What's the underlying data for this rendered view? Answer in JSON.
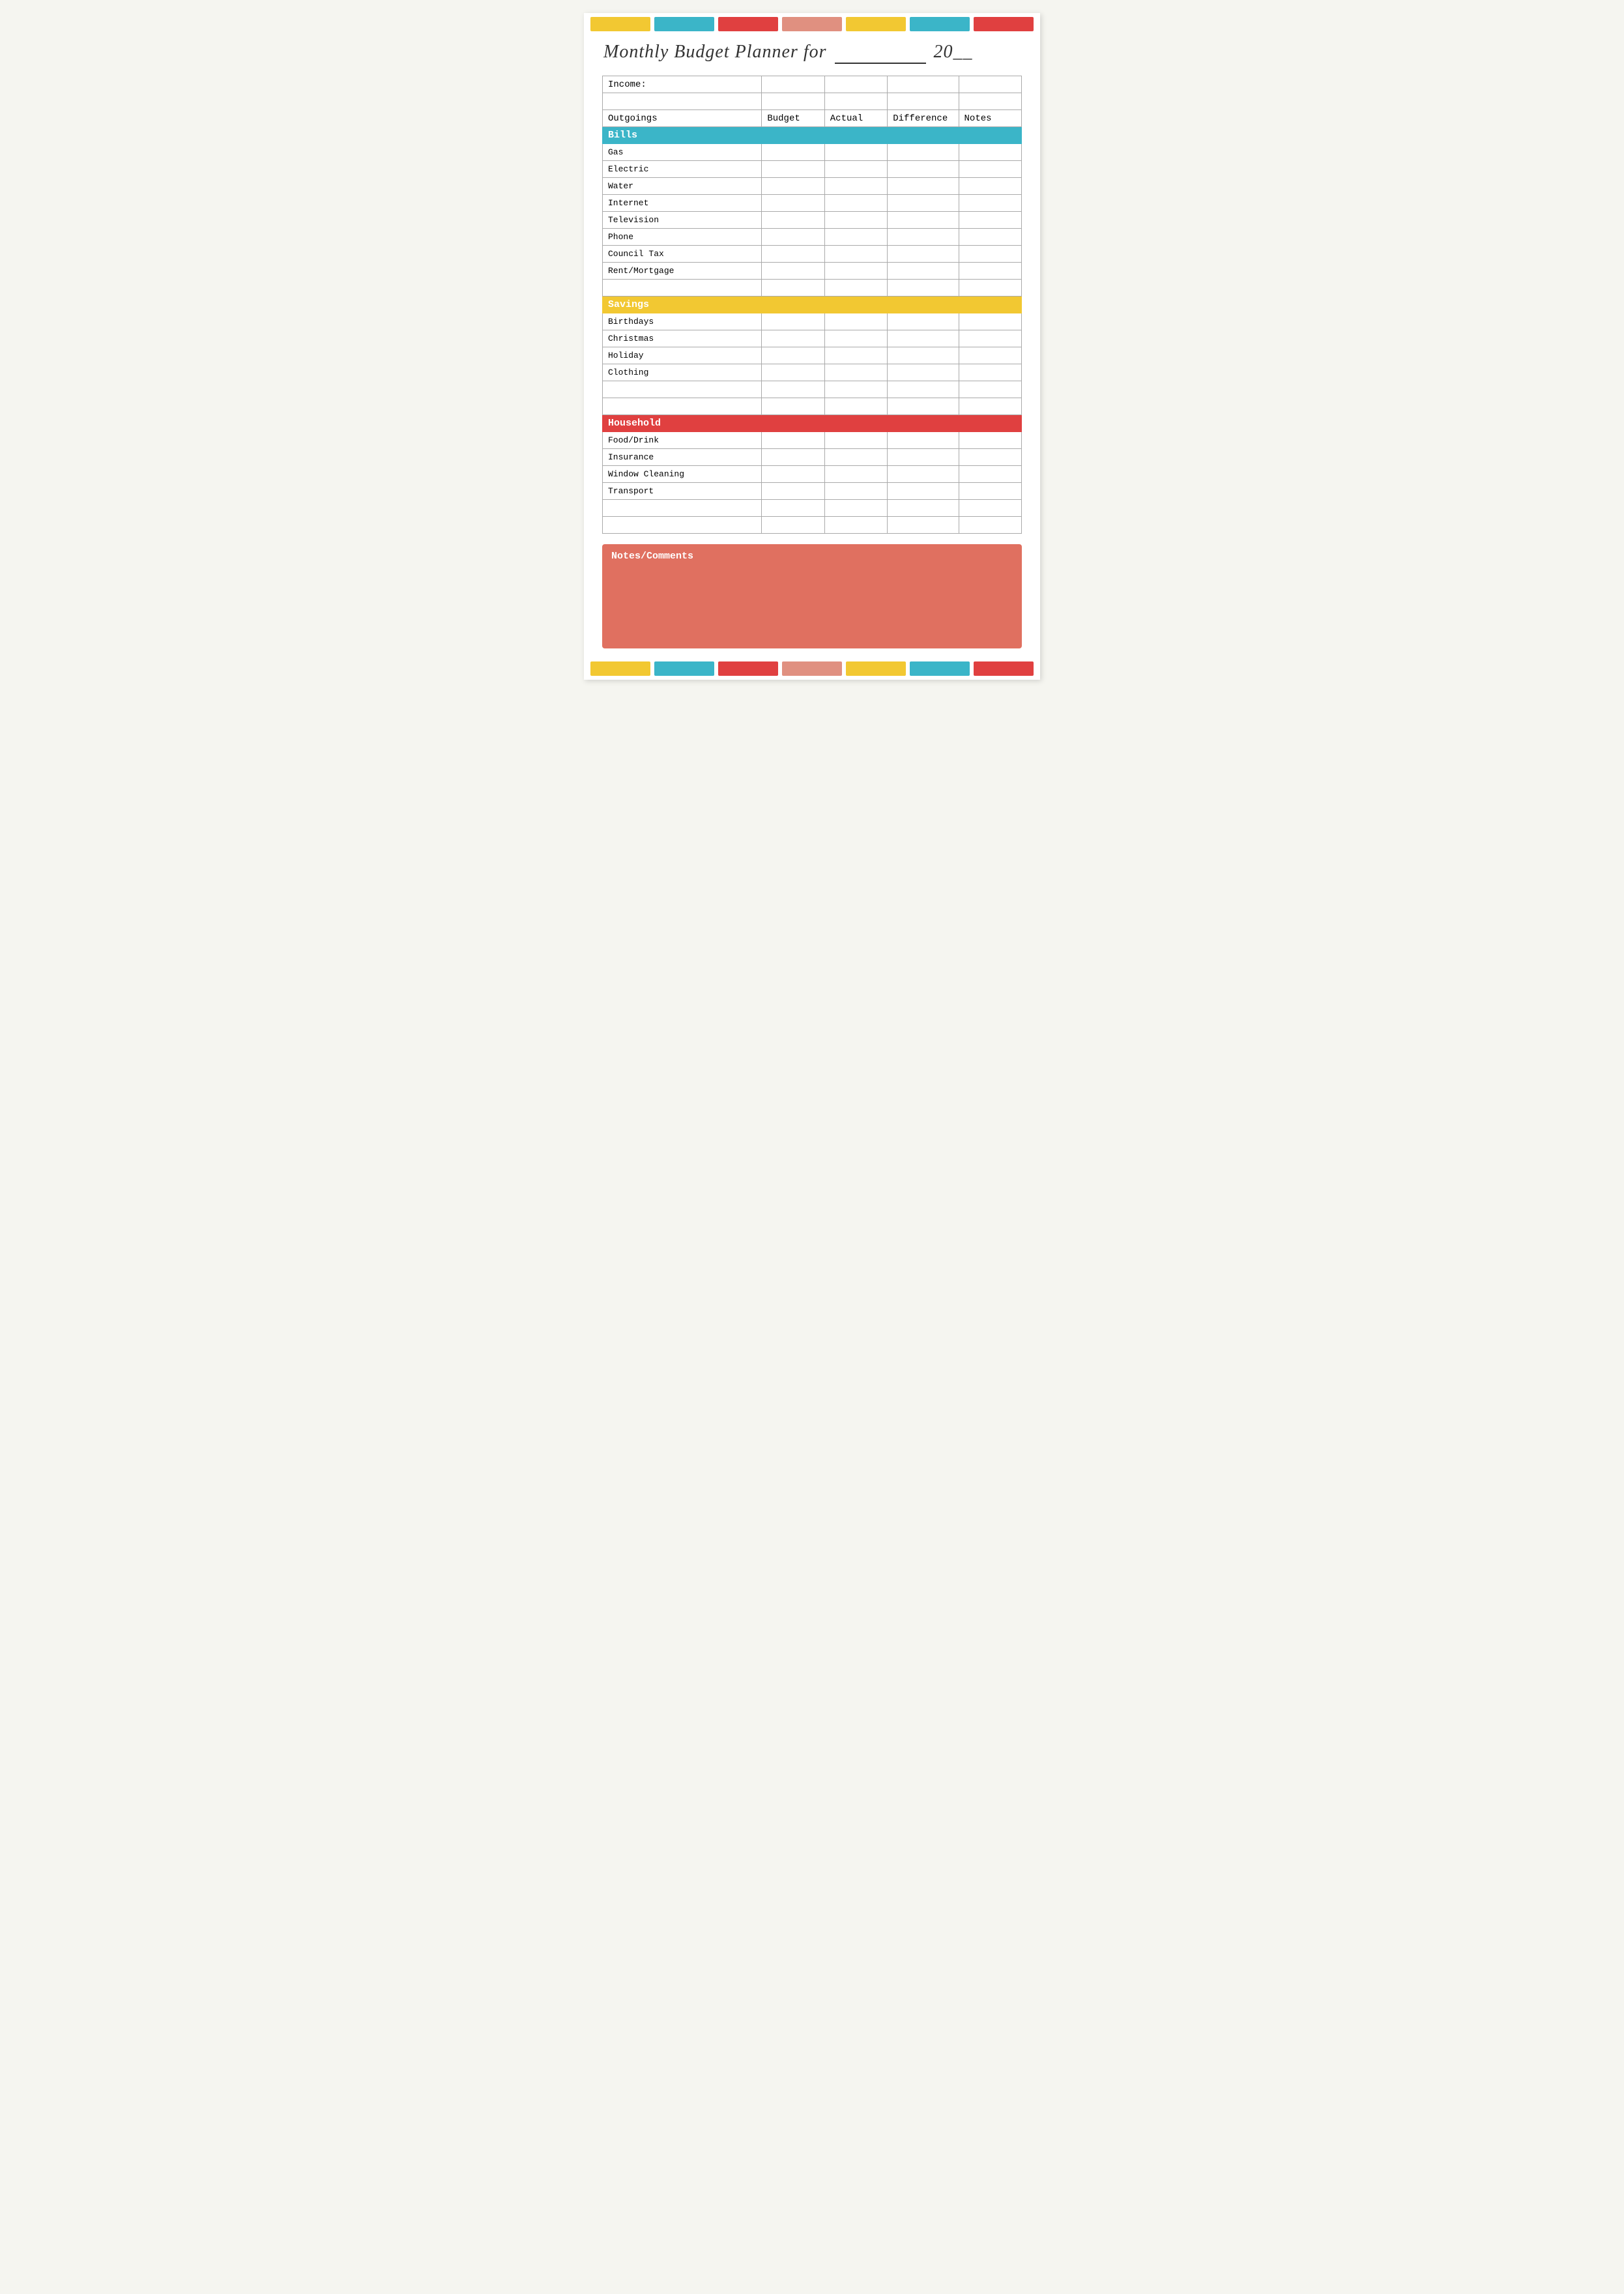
{
  "colorBar": {
    "segments": [
      "yellow",
      "teal",
      "red",
      "salmon",
      "yellow2",
      "teal2",
      "red2"
    ]
  },
  "title": {
    "prefix": "Monthly Budget Planner for",
    "blank": "___________",
    "year_prefix": "20",
    "year_blank": "__"
  },
  "table": {
    "income_label": "Income:",
    "headers": [
      "Outgoings",
      "Budget",
      "Actual",
      "Difference",
      "Notes"
    ],
    "sections": [
      {
        "name": "Bills",
        "color": "teal",
        "rows": [
          "Gas",
          "Electric",
          "Water",
          "Internet",
          "Television",
          "Phone",
          "Council Tax",
          "Rent/Mortgage",
          ""
        ]
      },
      {
        "name": "Savings",
        "color": "yellow",
        "rows": [
          "Birthdays",
          "Christmas",
          "Holiday",
          "Clothing",
          "",
          ""
        ]
      },
      {
        "name": "Household",
        "color": "red",
        "rows": [
          "Food/Drink",
          "Insurance",
          "Window Cleaning",
          "Transport",
          "",
          ""
        ]
      }
    ]
  },
  "notes": {
    "label": "Notes/Comments"
  }
}
